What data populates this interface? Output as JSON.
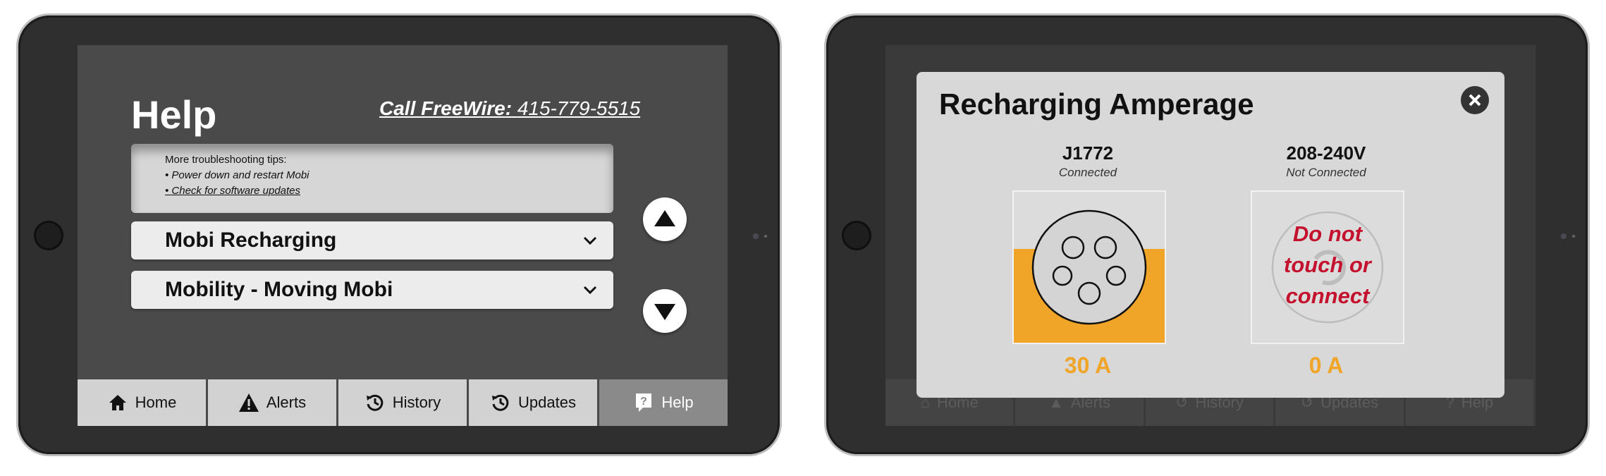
{
  "left": {
    "title": "Help",
    "call_label": "Call FreeWire:",
    "call_number": "415-779-5515",
    "tips": {
      "heading": "More troubleshooting tips:",
      "items": [
        "• Power down and restart Mobi",
        "• Check for software updates"
      ]
    },
    "sections": [
      {
        "label": "Mobi Recharging"
      },
      {
        "label": "Mobility - Moving Mobi"
      }
    ],
    "nav": [
      {
        "label": "Home",
        "icon": "home-icon"
      },
      {
        "label": "Alerts",
        "icon": "alert-icon"
      },
      {
        "label": "History",
        "icon": "history-icon"
      },
      {
        "label": "Updates",
        "icon": "updates-icon"
      },
      {
        "label": "Help",
        "icon": "help-icon",
        "active": true
      }
    ]
  },
  "right": {
    "modal_title": "Recharging Amperage",
    "columns": [
      {
        "name": "J1772",
        "status": "Connected",
        "amperage": "30 A",
        "fill_fraction": 0.62
      },
      {
        "name": "208-240V",
        "status": "Not Connected",
        "amperage": "0 A",
        "warning": [
          "Do not",
          "touch or",
          "connect"
        ]
      }
    ],
    "nav": [
      {
        "label": "Home"
      },
      {
        "label": "Alerts"
      },
      {
        "label": "History"
      },
      {
        "label": "Updates"
      },
      {
        "label": "Help"
      }
    ]
  },
  "colors": {
    "accent": "#f0a428",
    "warning": "#c4122e",
    "screen_bg": "#4a4a4a"
  }
}
